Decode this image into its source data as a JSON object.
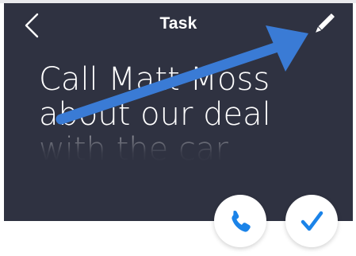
{
  "header": {
    "title": "Task"
  },
  "task": {
    "lines": [
      "Call Matt Moss",
      "about our deal",
      "with the car"
    ]
  },
  "colors": {
    "header_bg": "#2f3241",
    "accent": "#1b83e8",
    "annotation_arrow": "#3a7bd5"
  },
  "icons": {
    "back": "chevron-left-icon",
    "edit": "pencil-icon",
    "call": "phone-icon",
    "done": "checkmark-icon"
  }
}
